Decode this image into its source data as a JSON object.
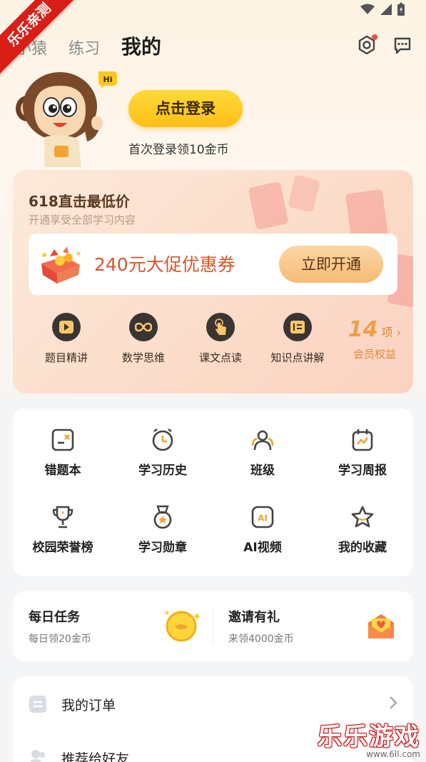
{
  "watermark": {
    "ribbon": "乐乐亲测",
    "corner_title": "乐乐游戏",
    "corner_url": "www.6ll.com"
  },
  "nav": {
    "tabs": [
      "小猿",
      "练习",
      "我的"
    ],
    "active": "我的"
  },
  "icons": {
    "settings": "settings-camera-icon",
    "messages": "chat-bubble-icon"
  },
  "mascot": {
    "badge": "Hi"
  },
  "login": {
    "button": "点击登录",
    "tip": "首次登录领10金币"
  },
  "vip": {
    "title": "618直击最低价",
    "subtitle": "开通享受全部学习内容",
    "coupon_text": "240元大促优惠券",
    "coupon_button": "立即开通",
    "perks": [
      {
        "label": "题目精讲",
        "icon": "play-icon"
      },
      {
        "label": "数学思维",
        "icon": "infinity-icon"
      },
      {
        "label": "课文点读",
        "icon": "finger-tap-icon"
      },
      {
        "label": "知识点讲解",
        "icon": "book-icon"
      }
    ],
    "more": {
      "count": "14",
      "unit": "项",
      "label": "会员权益"
    }
  },
  "tools": [
    {
      "label": "错题本",
      "icon": "wrong-book-icon"
    },
    {
      "label": "学习历史",
      "icon": "clock-icon"
    },
    {
      "label": "班级",
      "icon": "class-people-icon"
    },
    {
      "label": "学习周报",
      "icon": "calendar-chart-icon"
    },
    {
      "label": "校园荣誉榜",
      "icon": "trophy-icon"
    },
    {
      "label": "学习勋章",
      "icon": "medal-icon"
    },
    {
      "label": "AI视频",
      "icon": "ai-video-icon"
    },
    {
      "label": "我的收藏",
      "icon": "star-icon"
    }
  ],
  "tasks": {
    "daily": {
      "title": "每日任务",
      "sub": "每日领20金币",
      "icon": "gold-coin-icon"
    },
    "invite": {
      "title": "邀请有礼",
      "sub": "来领4000金币",
      "icon": "gift-envelope-icon"
    }
  },
  "list": [
    {
      "label": "我的订单",
      "icon": "order-icon"
    },
    {
      "label": "推荐给好友",
      "icon": "friends-icon"
    }
  ],
  "colors": {
    "accent": "#ffc61f",
    "vip_text": "#d8562a",
    "perk_more": "#e8a14a"
  }
}
